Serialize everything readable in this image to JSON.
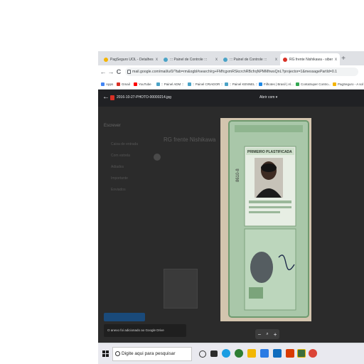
{
  "browser": {
    "tabs": [
      {
        "title": "PagSeguro UOL - Detalhes da tr",
        "color": "#f4b400",
        "active": false
      },
      {
        "title": "::: Painel de Controle :::",
        "color": "#4ba3c7",
        "active": false
      },
      {
        "title": "::: Painel de Controle :::",
        "color": "#4ba3c7",
        "active": false
      },
      {
        "title": "RG frente Nishikawa - sibernet@",
        "color": "#d93025",
        "active": true
      }
    ],
    "tab_close": "x",
    "new_tab": "+",
    "nav": {
      "back": "←",
      "forward": "→",
      "reload": "C"
    },
    "url": "mail.google.com/mail/u/0/?tab=rm&ogbl#search/rg+FMfcgxmRSkcrchRBcfrqNPMMhwsQnL?projector=1&messagePartId=0.1",
    "bookmarks": [
      {
        "label": "Apps",
        "color": "#4285f4"
      },
      {
        "label": "Gmail",
        "color": "#d93025"
      },
      {
        "label": "YouTube",
        "color": "#ff0000"
      },
      {
        "label": ":: Painel ADM ::",
        "color": "#4ba3c7"
      },
      {
        "label": ":: Painel CRIADOR ::",
        "color": "#4ba3c7"
      },
      {
        "label": ":: Painel KENNEL ::",
        "color": "#4ba3c7"
      },
      {
        "label": "Filhotes | Brasil | Al...",
        "color": "#1e88e5"
      },
      {
        "label": "ContaSuper Contro...",
        "color": "#34a853"
      },
      {
        "label": "PagSeguro - A sol",
        "color": "#f4b400"
      }
    ]
  },
  "viewer": {
    "file_name": "2016-10-27-PHOTO-00000214.jpg",
    "open_with": "Abrir com",
    "zoom_out": "−",
    "zoom_icon": "search",
    "zoom_in": "+",
    "document_text": {
      "number": "8610-8",
      "stamp": "PRIMEIRO PLASTIFICADA"
    }
  },
  "background_mail": {
    "compose": "Escrever",
    "subject": "RG frente Nishikawa",
    "folders": [
      "Caixa de entrada",
      "Com estrela",
      "Adiados",
      "Importante",
      "Enviados"
    ],
    "snackbar": "O anexo foi adicionado ao Google Drive"
  },
  "taskbar": {
    "search_placeholder": "Digite aqui para pesquisar",
    "apps": [
      {
        "name": "task-view",
        "color": "#2b2b2b"
      },
      {
        "name": "edge",
        "color": "#1b9de2"
      },
      {
        "name": "chrome-a",
        "color": "#2e7d32"
      },
      {
        "name": "files",
        "color": "#f2b705"
      },
      {
        "name": "store",
        "color": "#2a7be4"
      },
      {
        "name": "mail",
        "color": "#0f6cbd"
      },
      {
        "name": "office",
        "color": "#d83b01"
      },
      {
        "name": "photos",
        "color": "#3c6e3c"
      },
      {
        "name": "chrome",
        "color": "#db4437"
      }
    ]
  }
}
